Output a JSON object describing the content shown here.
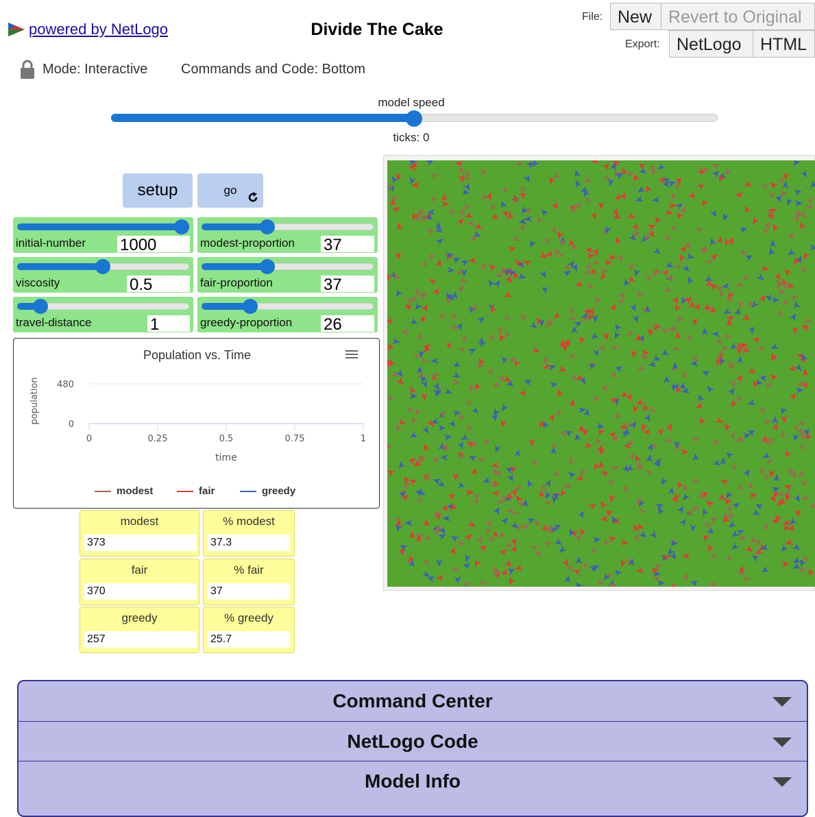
{
  "header": {
    "logo_text": " powered by NetLogo",
    "title": "Divide The Cake",
    "file_label": "File:",
    "new_label": "New",
    "revert_label": "Revert to Original",
    "export_label": "Export:",
    "export_netlogo": "NetLogo",
    "export_html": "HTML",
    "mode_text": "Mode: Interactive",
    "commands_text": "Commands and Code: Bottom"
  },
  "speed": {
    "label": "model speed",
    "value": 0.5,
    "ticks_text": "ticks: 0"
  },
  "buttons": {
    "setup": "setup",
    "go": "go"
  },
  "sliders": [
    {
      "name": "initial-number",
      "value": "1000",
      "fraction": 1.0
    },
    {
      "name": "viscosity",
      "value": "0.5",
      "fraction": 0.5
    },
    {
      "name": "travel-distance",
      "value": "1",
      "fraction": 0.14
    },
    {
      "name": "modest-proportion",
      "value": "37",
      "fraction": 0.37
    },
    {
      "name": "fair-proportion",
      "value": "37",
      "fraction": 0.37
    },
    {
      "name": "greedy-proportion",
      "value": "26",
      "fraction": 0.27
    }
  ],
  "chart_data": {
    "type": "line",
    "title": "Population vs. Time",
    "xlabel": "time",
    "ylabel": "population",
    "xlim": [
      0,
      1
    ],
    "ylim": [
      0,
      480
    ],
    "x_ticks": [
      "0",
      "0.25",
      "0.5",
      "0.75",
      "1"
    ],
    "y_ticks": [
      "480",
      "0"
    ],
    "series": [
      {
        "name": "modest",
        "values": [],
        "color": "#9c6b4e"
      },
      {
        "name": "fair",
        "values": [],
        "color": "#e53935"
      },
      {
        "name": "greedy",
        "values": [],
        "color": "#3f5fb5"
      }
    ],
    "grid": true,
    "legend": "bottom"
  },
  "monitors": [
    {
      "label": "modest",
      "value": "373"
    },
    {
      "label": "% modest",
      "value": "37.3"
    },
    {
      "label": "fair",
      "value": "370"
    },
    {
      "label": "% fair",
      "value": "37"
    },
    {
      "label": "greedy",
      "value": "257"
    },
    {
      "label": "% greedy",
      "value": "25.7"
    }
  ],
  "world": {
    "background_color": "#55a630",
    "turtle_colors": [
      "#e53935",
      "#3f5fb5",
      "#9c6b4e"
    ]
  },
  "accordions": [
    {
      "label": "Command Center"
    },
    {
      "label": "NetLogo Code"
    },
    {
      "label": "Model Info"
    }
  ],
  "colors": {
    "button_bg": "#bacef0",
    "slider_bg": "#8fe38a",
    "monitor_bg": "#fdfd99",
    "accordion_bg": "#bcbce6",
    "accent": "#1976d2"
  }
}
